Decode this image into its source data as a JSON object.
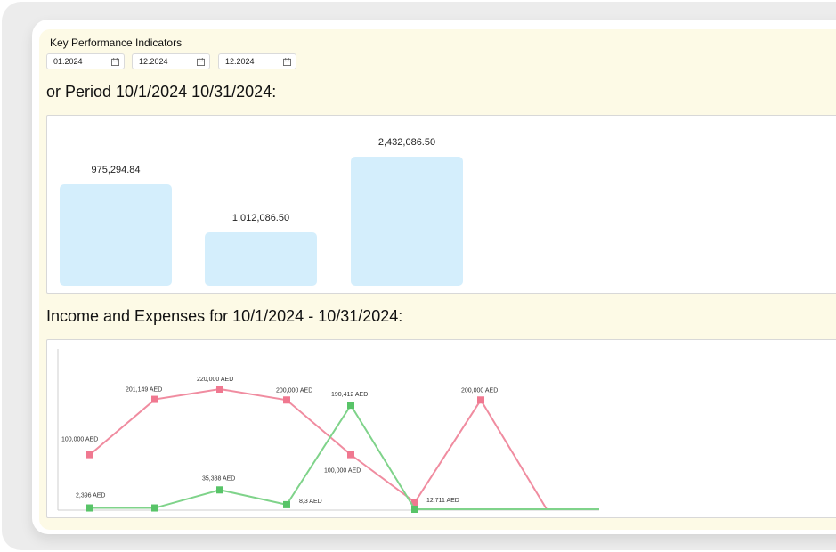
{
  "kpi": {
    "title": "Key Performance Indicators",
    "dates": [
      "01.2024",
      "12.2024",
      "12.2024"
    ]
  },
  "period_heading": "or Period 10/1/2024 10/31/2024:",
  "income_heading": "Income and Expenses for 10/1/2024 - 10/31/2024:",
  "colors": {
    "bar_fill": "#d4eefc",
    "income_line": "#f08ca0",
    "income_marker": "#f07890",
    "expense_line": "#7fd38a",
    "expense_marker": "#58c468",
    "background": "#fdfae6"
  },
  "chart_data": [
    {
      "type": "bar",
      "categories": [
        "",
        "",
        ""
      ],
      "values": [
        975294.84,
        1012086.5,
        2432086.5
      ],
      "data_labels": [
        "975,294.84",
        "1,012,086.50",
        "2,432,086.50"
      ]
    },
    {
      "type": "line",
      "series": [
        {
          "values": [
            100000,
            201149,
            220000,
            200000,
            100000,
            12711,
            200000,
            0
          ],
          "labels": [
            "100,000 AED",
            "201,149 AED",
            "220,000 AED",
            "200,000 AED",
            "100,000 AED",
            "12,711 AED",
            "200,000 AED",
            ""
          ]
        },
        {
          "values": [
            2396,
            2396,
            35388,
            8300,
            190412,
            0,
            0,
            0
          ],
          "labels": [
            "2,396 AED",
            "",
            "35,388 AED",
            "8,3 AED",
            "190,412 AED",
            "",
            "",
            ""
          ]
        }
      ]
    }
  ]
}
